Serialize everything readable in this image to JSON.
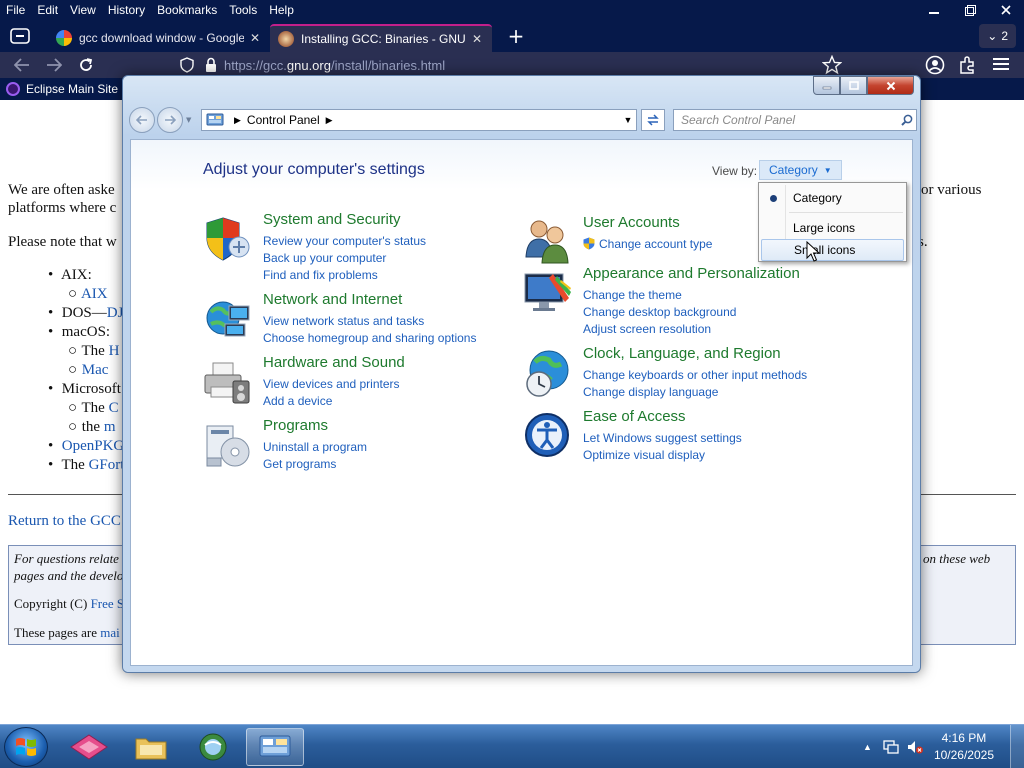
{
  "firefox": {
    "menu": [
      "File",
      "Edit",
      "View",
      "History",
      "Bookmarks",
      "Tools",
      "Help"
    ],
    "tabs": [
      {
        "title": "gcc download window - Google"
      },
      {
        "title": "Installing GCC: Binaries - GNU P"
      }
    ],
    "tab_count": "2",
    "url": {
      "prefix": "https://gcc.",
      "host": "gnu.org",
      "path": "/install/binaries.html"
    },
    "bookmarks": [
      "Eclipse Main Site"
    ]
  },
  "webpage": {
    "para1_line1": "We are often aske",
    "para1_line1_end": "or various",
    "para1_line2": "platforms where c",
    "para2": "Please note that w",
    "para2_end": "s.",
    "list": {
      "aix": "AIX:",
      "aix_sub": "AIX",
      "dos_prefix": "DOS—",
      "dos_link": "DJG",
      "macos": "macOS:",
      "mac_sub1_prefix": "The",
      "mac_sub1_link": "H",
      "mac_sub2_link": "Mac",
      "ms": "Microsoft W",
      "ms_sub1_prefix": "The",
      "ms_sub1_link": "C",
      "ms_sub2_prefix": "the",
      "ms_sub2_link": "m",
      "openpkg": "OpenPKG",
      "openpkg_rest": "c",
      "gfortran_prefix": "The",
      "gfortran_link": "GFortr"
    },
    "return_link": "Return to the GCC",
    "footer": {
      "line1": "For questions relate",
      "line1_end": "on these web",
      "line2": "pages and the develo",
      "copyright_prefix": "Copyright (C)",
      "copyright_link": "Free S",
      "maintained_prefix": "These pages are",
      "maintained_link": "mai"
    }
  },
  "control_panel": {
    "address": {
      "root": "Control Panel"
    },
    "search_placeholder": "Search Control Panel",
    "heading": "Adjust your computer's settings",
    "view_by_label": "View by:",
    "view_by_value": "Category",
    "view_by_options": [
      "Category",
      "Large icons",
      "Small icons"
    ],
    "selected_option": "Category",
    "categories": [
      {
        "icon": "shield-icon",
        "title": "System and Security",
        "links": [
          "Review your computer's status",
          "Back up your computer",
          "Find and fix problems"
        ]
      },
      {
        "icon": "network-icon",
        "title": "Network and Internet",
        "links": [
          "View network status and tasks",
          "Choose homegroup and sharing options"
        ]
      },
      {
        "icon": "printer-icon",
        "title": "Hardware and Sound",
        "links": [
          "View devices and printers",
          "Add a device"
        ]
      },
      {
        "icon": "programs-icon",
        "title": "Programs",
        "links": [
          "Uninstall a program",
          "Get programs"
        ]
      },
      {
        "icon": "users-icon",
        "title": "User Accounts",
        "links": [
          "Change account type"
        ]
      },
      {
        "icon": "appearance-icon",
        "title": "Appearance and Personalization",
        "links": [
          "Change the theme",
          "Change desktop background",
          "Adjust screen resolution"
        ]
      },
      {
        "icon": "globe-clock-icon",
        "title": "Clock, Language, and Region",
        "links": [
          "Change keyboards or other input methods",
          "Change display language"
        ]
      },
      {
        "icon": "ease-of-access-icon",
        "title": "Ease of Access",
        "links": [
          "Let Windows suggest settings",
          "Optimize visual display"
        ]
      }
    ]
  },
  "taskbar": {
    "time": "4:16 PM",
    "date": "10/26/2025"
  },
  "colors": {
    "firefox_dark": "#06194a",
    "link_blue": "#1f5fbd",
    "category_green": "#1e7a2e",
    "heading_blue": "#1e3287"
  }
}
